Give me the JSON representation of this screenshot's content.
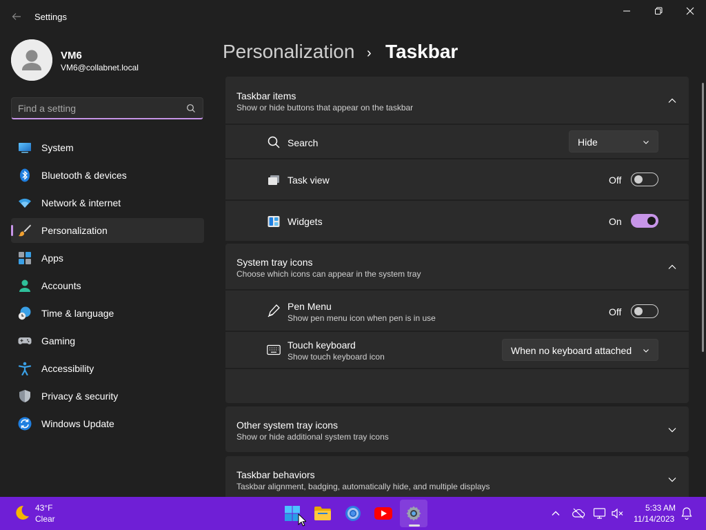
{
  "window": {
    "title": "Settings",
    "back_icon": "back-arrow-icon",
    "controls": [
      "minimize-icon",
      "restore-icon",
      "close-icon"
    ]
  },
  "profile": {
    "name": "VM6",
    "email": "VM6@collabnet.local"
  },
  "search": {
    "placeholder": "Find a setting",
    "value": ""
  },
  "nav": {
    "items": [
      {
        "label": "System",
        "icon": "system-icon",
        "active": false
      },
      {
        "label": "Bluetooth & devices",
        "icon": "bluetooth-icon",
        "active": false
      },
      {
        "label": "Network & internet",
        "icon": "wifi-icon",
        "active": false
      },
      {
        "label": "Personalization",
        "icon": "brush-icon",
        "active": true
      },
      {
        "label": "Apps",
        "icon": "apps-icon",
        "active": false
      },
      {
        "label": "Accounts",
        "icon": "accounts-icon",
        "active": false
      },
      {
        "label": "Time & language",
        "icon": "time-language-icon",
        "active": false
      },
      {
        "label": "Gaming",
        "icon": "gamepad-icon",
        "active": false
      },
      {
        "label": "Accessibility",
        "icon": "accessibility-icon",
        "active": false
      },
      {
        "label": "Privacy & security",
        "icon": "shield-icon",
        "active": false
      },
      {
        "label": "Windows Update",
        "icon": "update-icon",
        "active": false
      }
    ]
  },
  "header": {
    "parent": "Personalization",
    "separator": "›",
    "current": "Taskbar"
  },
  "taskbar_items": {
    "title": "Taskbar items",
    "subtitle": "Show or hide buttons that appear on the taskbar",
    "search": {
      "label": "Search",
      "value": "Hide"
    },
    "task_view": {
      "label": "Task view",
      "state": "Off"
    },
    "widgets": {
      "label": "Widgets",
      "state": "On"
    }
  },
  "system_tray": {
    "title": "System tray icons",
    "subtitle": "Choose which icons can appear in the system tray",
    "pen_menu": {
      "label": "Pen Menu",
      "subtitle": "Show pen menu icon when pen is in use",
      "state": "Off"
    },
    "touch_keyboard": {
      "label": "Touch keyboard",
      "subtitle": "Show touch keyboard icon",
      "value": "When no keyboard attached"
    }
  },
  "other_tray": {
    "title": "Other system tray icons",
    "subtitle": "Show or hide additional system tray icons"
  },
  "behaviors": {
    "title": "Taskbar behaviors",
    "subtitle": "Taskbar alignment, badging, automatically hide, and multiple displays"
  },
  "os_taskbar": {
    "temp": "43°F",
    "condition": "Clear",
    "time": "5:33 AM",
    "date": "11/14/2023",
    "apps": [
      "start-icon",
      "file-explorer-icon",
      "chrome-icon",
      "youtube-icon",
      "settings-gear-icon"
    ],
    "tray": [
      "chevron-up-icon",
      "onedrive-icon",
      "network-icon",
      "volume-mute-icon",
      "notification-bell-icon"
    ]
  },
  "colors": {
    "accent": "#c795e8",
    "background": "#202020",
    "card": "#2b2b2b",
    "taskbar": "#6f1fd6"
  }
}
